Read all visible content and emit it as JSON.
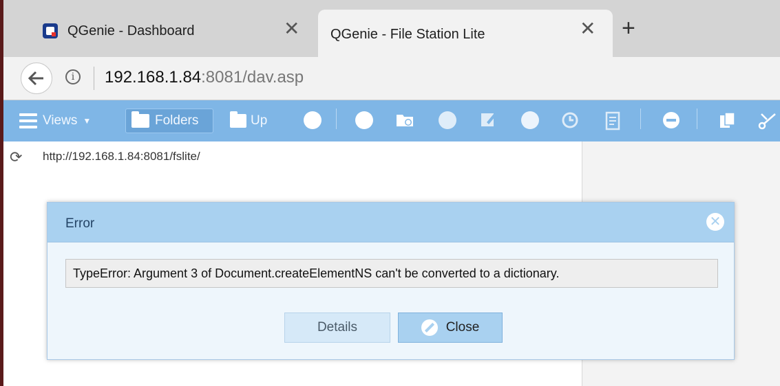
{
  "browser": {
    "tabs": [
      {
        "title": "QGenie - Dashboard",
        "active": false
      },
      {
        "title": "QGenie - File Station Lite",
        "active": true
      }
    ],
    "tab_close_glyph": "✕",
    "new_tab_glyph": "+",
    "url_host": "192.168.1.84",
    "url_rest": ":8081/dav.asp"
  },
  "toolbar": {
    "views_label": "Views",
    "folders_label": "Folders",
    "up_label": "Up"
  },
  "content": {
    "path": "http://192.168.1.84:8081/fslite/"
  },
  "dialog": {
    "title": "Error",
    "message": "TypeError: Argument 3 of Document.createElementNS can't be converted to a dictionary.",
    "details_label": "Details",
    "close_label": "Close"
  },
  "colors": {
    "toolbar": "#7fb6e6",
    "dialog_header": "#a9d1f0",
    "favicon": "#1a3b8c"
  }
}
